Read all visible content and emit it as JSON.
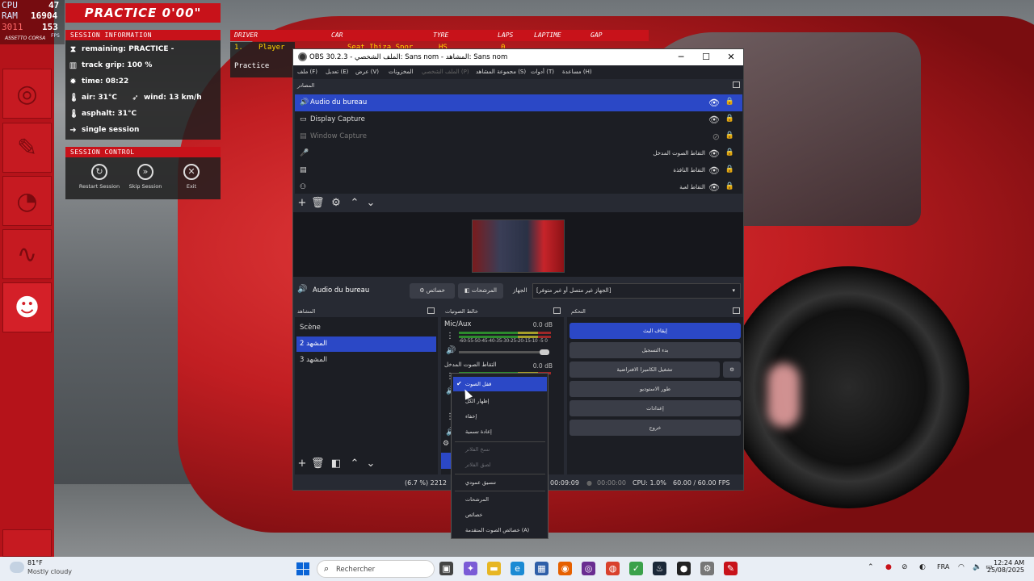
{
  "hud": {
    "cpu_label": "CPU",
    "cpu_value": "47",
    "ram_label": "RAM",
    "ram_value": "16904",
    "mem_value": "3011",
    "fps_value": "153",
    "fps_label": "FPS",
    "brand": "ASSETTO CORSA",
    "practice_title": "PRACTICE 0'00\"",
    "session_info_header": "SESSION INFORMATION",
    "remaining": "remaining: PRACTICE -",
    "track_grip": "track grip: 100 %",
    "time": "time: 08:22",
    "air": "air: 31°C",
    "wind": "wind: 13 km/h",
    "asphalt": "asphalt: 31°C",
    "session_type": "single session",
    "session_control_header": "SESSION CONTROL",
    "restart_label": "Restart Session",
    "skip_label": "Skip Session",
    "exit_label": "Exit"
  },
  "leaderboard": {
    "columns": [
      "DRIVER",
      "CAR",
      "TYRE",
      "LAPS",
      "LAPTIME",
      "GAP"
    ],
    "row_position": "1.",
    "row_driver": "Player",
    "row_car": "Seat Ibiza Spor",
    "row_tyre": "HS",
    "row_laps": "0",
    "session_label": "Practice"
  },
  "obs": {
    "title": "OBS 30.2.3 - الملف الشخصي: Sans nom - المشاهد: Sans nom",
    "menu": [
      "ملف (F)",
      "تعديل (E)",
      "عرض (V)",
      "المخزونات",
      "الملف الشخصي (P)",
      "مجموعة المشاهد (S)",
      "أدوات (T)",
      "مساعدة (H)"
    ],
    "sources_title": "المصادر",
    "sources": [
      {
        "name": "Audio du bureau",
        "icon": "speaker-icon",
        "selected": true,
        "visible": true,
        "rtl": false
      },
      {
        "name": "Display Capture",
        "icon": "monitor-icon",
        "selected": false,
        "visible": true,
        "rtl": false
      },
      {
        "name": "Window Capture",
        "icon": "window-icon",
        "selected": false,
        "visible": false,
        "rtl": false
      },
      {
        "name": "التقاط الصوت المدخل",
        "icon": "mic-icon",
        "selected": false,
        "visible": true,
        "rtl": true
      },
      {
        "name": "التقاط النافذة",
        "icon": "window-icon",
        "selected": false,
        "visible": true,
        "rtl": true
      },
      {
        "name": "التقاط لعبة",
        "icon": "gamepad-icon",
        "selected": false,
        "visible": true,
        "rtl": true
      }
    ],
    "audio_source_name": "Audio du bureau",
    "properties_label": "خصائص",
    "filters_label": "المرشحات",
    "device_label": "الجهاز",
    "device_value": "[الجهاز غير متصل أو غير متوفر]",
    "scenes_title": "المشاهد",
    "scenes": [
      "Scène",
      "المشهد 2",
      "المشهد 3"
    ],
    "scenes_selected": 1,
    "mixer_title": "خالط الصوتيات",
    "mixer": [
      {
        "name": "Mic/Aux",
        "db": "0.0 dB"
      },
      {
        "name": "التقاط الصوت المدخل",
        "db": "0.0 dB"
      }
    ],
    "meter_ticks": "-60-55-50-45-40-35-30-25-20-15-10 -5  0",
    "controls_title": "التحكم",
    "controls": [
      "إيقاف البث",
      "بدء التسجيل",
      "تشغيل الكاميرا الافتراضية",
      "طور الاستوديو",
      "إعدادات",
      "خروج"
    ],
    "status_frames": "(6.7 %) 2212",
    "status_stream_time": "00:09:09",
    "status_rec_time": "00:00:00",
    "status_cpu": "CPU: 1.0%",
    "status_fps": "60.00 / 60.00 FPS"
  },
  "context_menu": {
    "items": [
      {
        "label": "قفل الصوت",
        "checked": true,
        "disabled": false,
        "selected": true
      },
      {
        "label": "إظهار الكل",
        "checked": false,
        "disabled": false,
        "selected": false
      },
      {
        "label": "إخفاء",
        "checked": false,
        "disabled": false,
        "selected": false
      },
      {
        "label": "إعادة تسمية",
        "checked": false,
        "disabled": false,
        "selected": false
      },
      {
        "label": "نسخ الفلاتر",
        "checked": false,
        "disabled": true,
        "selected": false
      },
      {
        "label": "لصق الفلاتر",
        "checked": false,
        "disabled": true,
        "selected": false
      },
      {
        "label": "تنسيق عمودي",
        "checked": false,
        "disabled": false,
        "selected": false
      },
      {
        "label": "المرشحات",
        "checked": false,
        "disabled": false,
        "selected": false
      },
      {
        "label": "خصائص",
        "checked": false,
        "disabled": false,
        "selected": false
      },
      {
        "label": "خصائص الصوت المتقدمة (A)",
        "checked": false,
        "disabled": false,
        "selected": false
      }
    ]
  },
  "taskbar": {
    "temperature": "81°F",
    "weather": "Mostly cloudy",
    "search_placeholder": "Rechercher",
    "language": "FRA",
    "time": "12:24 AM",
    "date": "25/08/2025"
  },
  "colors": {
    "accent": "#2b48c6",
    "hud_red": "#c8121a",
    "obs_bg": "#272a33"
  }
}
